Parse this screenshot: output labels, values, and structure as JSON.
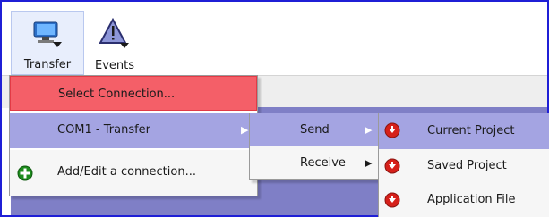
{
  "toolbar": {
    "transfer_label": "Transfer",
    "events_label": "Events"
  },
  "main_menu": {
    "items": [
      {
        "label": "Select Connection...",
        "icon": "none"
      },
      {
        "label": "COM1 - Transfer",
        "icon": "none",
        "has_submenu": true
      },
      {
        "label": "Add/Edit a connection...",
        "icon": "plus-icon"
      }
    ]
  },
  "transfer_submenu": {
    "items": [
      {
        "label": "Send",
        "has_submenu": true
      },
      {
        "label": "Receive",
        "has_submenu": true
      }
    ]
  },
  "send_submenu": {
    "items": [
      {
        "label": "Current Project",
        "icon": "down-arrow-icon"
      },
      {
        "label": "Saved Project",
        "icon": "down-arrow-icon"
      },
      {
        "label": "Application File",
        "icon": "down-arrow-icon"
      }
    ]
  },
  "colors": {
    "frame_border": "#1f1fd6",
    "highlight": "#a4a4e2",
    "selected_red": "#f45f68",
    "menu_bg": "#f6f6f6",
    "icon_red": "#d6201a",
    "plus_green": "#1d8c1d"
  }
}
